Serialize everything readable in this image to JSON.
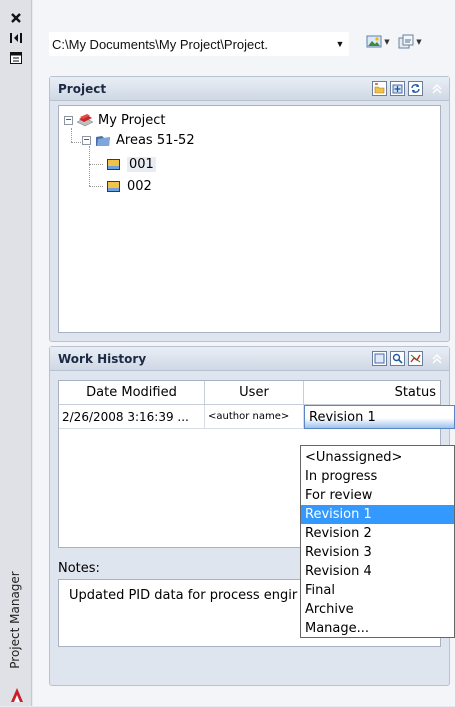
{
  "palette": {
    "title": "Project Manager"
  },
  "toolbar": {
    "project_path": "C:\\My Documents\\My Project\\Project."
  },
  "project_panel": {
    "title": "Project",
    "tree": {
      "root": "My Project",
      "area": "Areas 51-52",
      "items": [
        "001",
        "002"
      ]
    }
  },
  "work_history": {
    "title": "Work History",
    "columns": [
      "Date Modified",
      "User",
      "Status"
    ],
    "rows": [
      {
        "date_modified": "2/26/2008 3:16:39 ...",
        "user": "<author name>",
        "status": "Revision 1"
      }
    ],
    "status_options": [
      "<Unassigned>",
      "In progress",
      "For review",
      "Revision 1",
      "Revision 2",
      "Revision 3",
      "Revision 4",
      "Final",
      "Archive",
      "Manage..."
    ],
    "selected_option": "Revision 1",
    "notes_label": "Notes:",
    "notes_value": "Updated PID data for process engir"
  },
  "colors": {
    "highlight": "#3399ff",
    "panel_header": "#cfd8e5"
  }
}
